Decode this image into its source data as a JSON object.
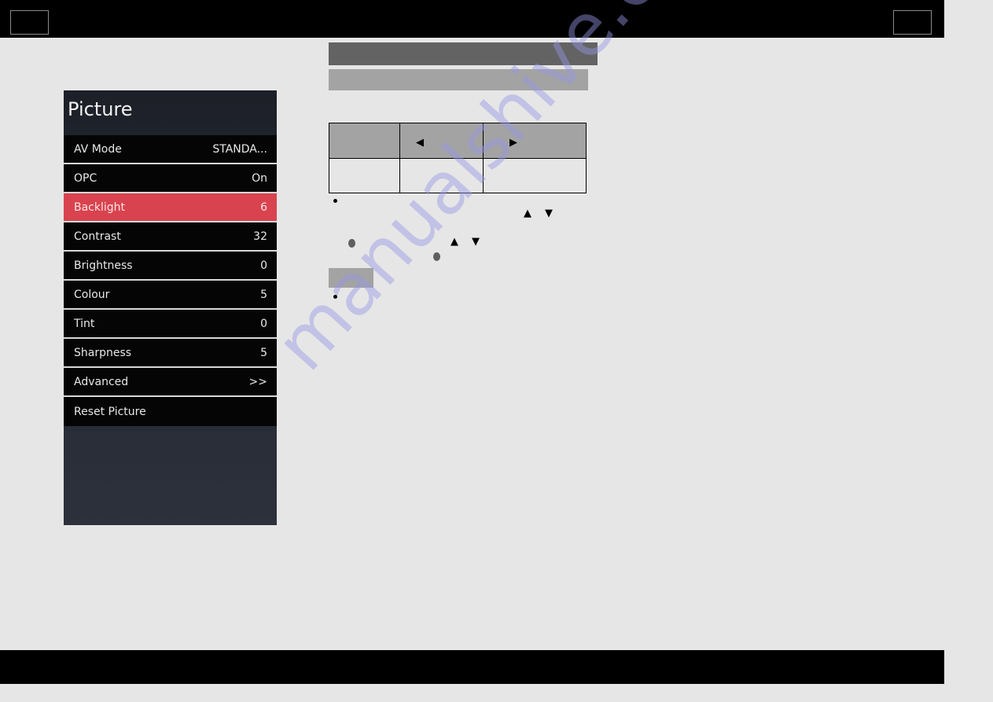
{
  "menu": {
    "title": "Picture",
    "items": [
      {
        "label": "AV Mode",
        "value": "STANDA..."
      },
      {
        "label": "OPC",
        "value": "On"
      },
      {
        "label": "Backlight",
        "value": "6"
      },
      {
        "label": "Contrast",
        "value": "32"
      },
      {
        "label": "Brightness",
        "value": "0"
      },
      {
        "label": "Colour",
        "value": "5"
      },
      {
        "label": "Tint",
        "value": "0"
      },
      {
        "label": "Sharpness",
        "value": "5"
      },
      {
        "label": "Advanced",
        "value": ">>"
      },
      {
        "label": "Reset Picture",
        "value": ""
      }
    ],
    "selected_index": 2,
    "highlight_color": "#d9434f"
  },
  "table": {
    "left_arrow": "◀",
    "right_arrow": "▶"
  },
  "icons": {
    "up": "▲",
    "down": "▼"
  },
  "watermark": "manualshive.com"
}
